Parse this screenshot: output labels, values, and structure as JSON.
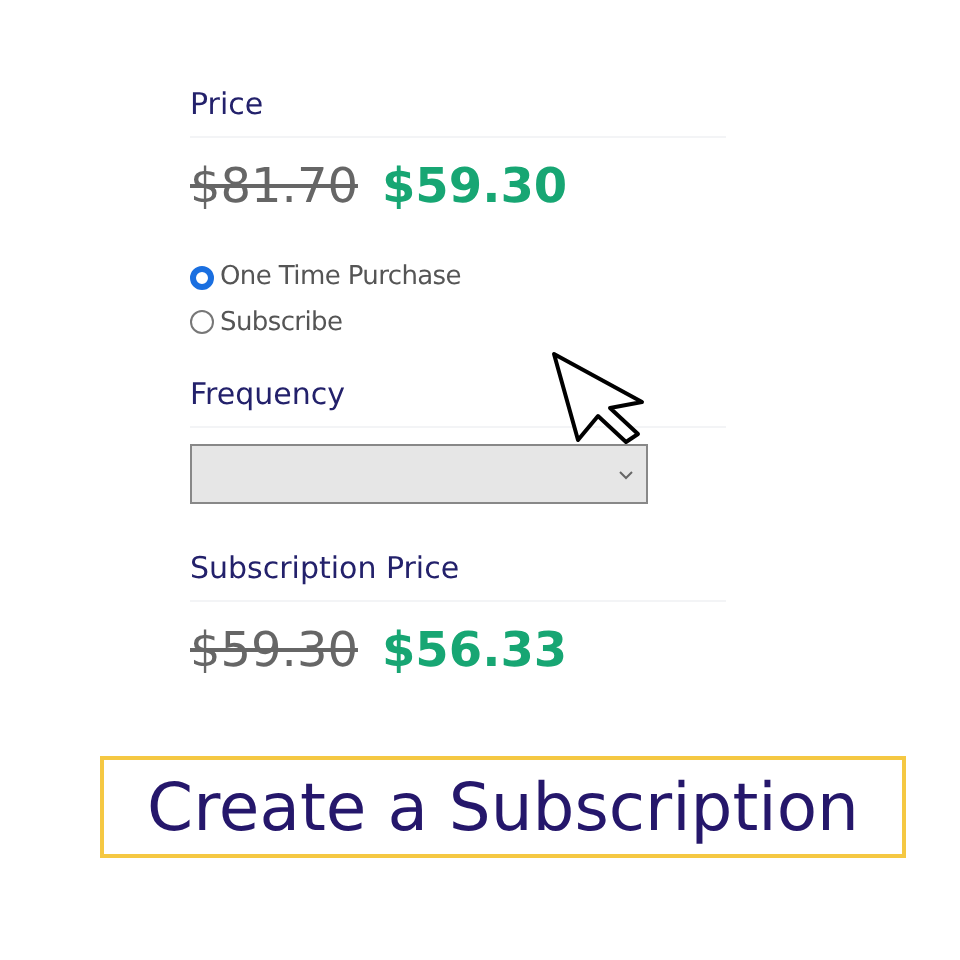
{
  "price": {
    "label": "Price",
    "original": "$81.70",
    "sale": "$59.30"
  },
  "purchase_options": [
    {
      "label": "One Time Purchase",
      "selected": true
    },
    {
      "label": "Subscribe",
      "selected": false
    }
  ],
  "frequency": {
    "label": "Frequency"
  },
  "subscription_price": {
    "label": "Subscription Price",
    "original": "$59.30",
    "sale": "$56.33"
  },
  "caption": "Create a Subscription"
}
